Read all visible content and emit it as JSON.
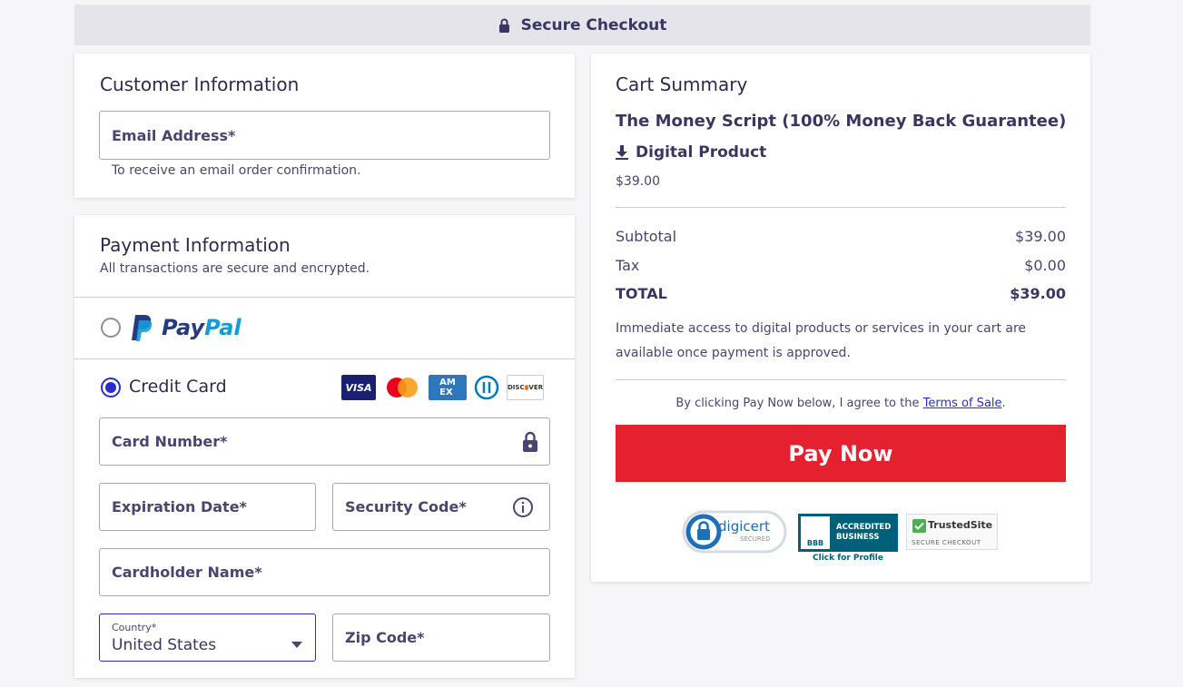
{
  "header": {
    "title": "Secure Checkout"
  },
  "customer": {
    "heading": "Customer Information",
    "email_placeholder": "Email Address*",
    "email_hint": "To receive an email order confirmation."
  },
  "payment": {
    "heading": "Payment Information",
    "subheading": "All transactions are secure and encrypted.",
    "paypal_label_pay": "Pay",
    "paypal_label_pal": "Pal",
    "credit_card_label": "Credit Card",
    "card_logos": [
      "VISA",
      "MASTERCARD",
      "AMEX",
      "DINERS",
      "DISCOVER"
    ],
    "card_number_placeholder": "Card Number*",
    "expiration_placeholder": "Expiration Date*",
    "security_placeholder": "Security Code*",
    "cardholder_placeholder": "Cardholder Name*",
    "country_label": "Country*",
    "country_value": "United States",
    "zip_placeholder": "Zip Code*"
  },
  "cart": {
    "heading": "Cart Summary",
    "product_name": "The Money Script (100% Money Back Guarantee)",
    "product_type": "Digital Product",
    "product_price": "$39.00",
    "subtotal_label": "Subtotal",
    "subtotal_value": "$39.00",
    "tax_label": "Tax",
    "tax_value": "$0.00",
    "total_label": "TOTAL",
    "total_value": "$39.00",
    "access_note": "Immediate access to digital products or services in your cart are available once payment is approved.",
    "agree_prefix": "By clicking Pay Now below, I agree to the",
    "terms_link": "Terms of Sale",
    "agree_suffix": ".",
    "pay_button": "Pay Now"
  },
  "badges": {
    "digicert": "digicert",
    "digicert_sub": "SECURED",
    "bbb_line1": "ACCREDITED",
    "bbb_line2": "BUSINESS",
    "bbb_logo": "BBB",
    "bbb_link": "Click for Profile",
    "trusted": "TrustedSite",
    "trusted_sub": "SECURE CHECKOUT"
  },
  "colors": {
    "accent": "#2a2bd0",
    "pay_button": "#e5212f",
    "text": "#3b3561"
  }
}
